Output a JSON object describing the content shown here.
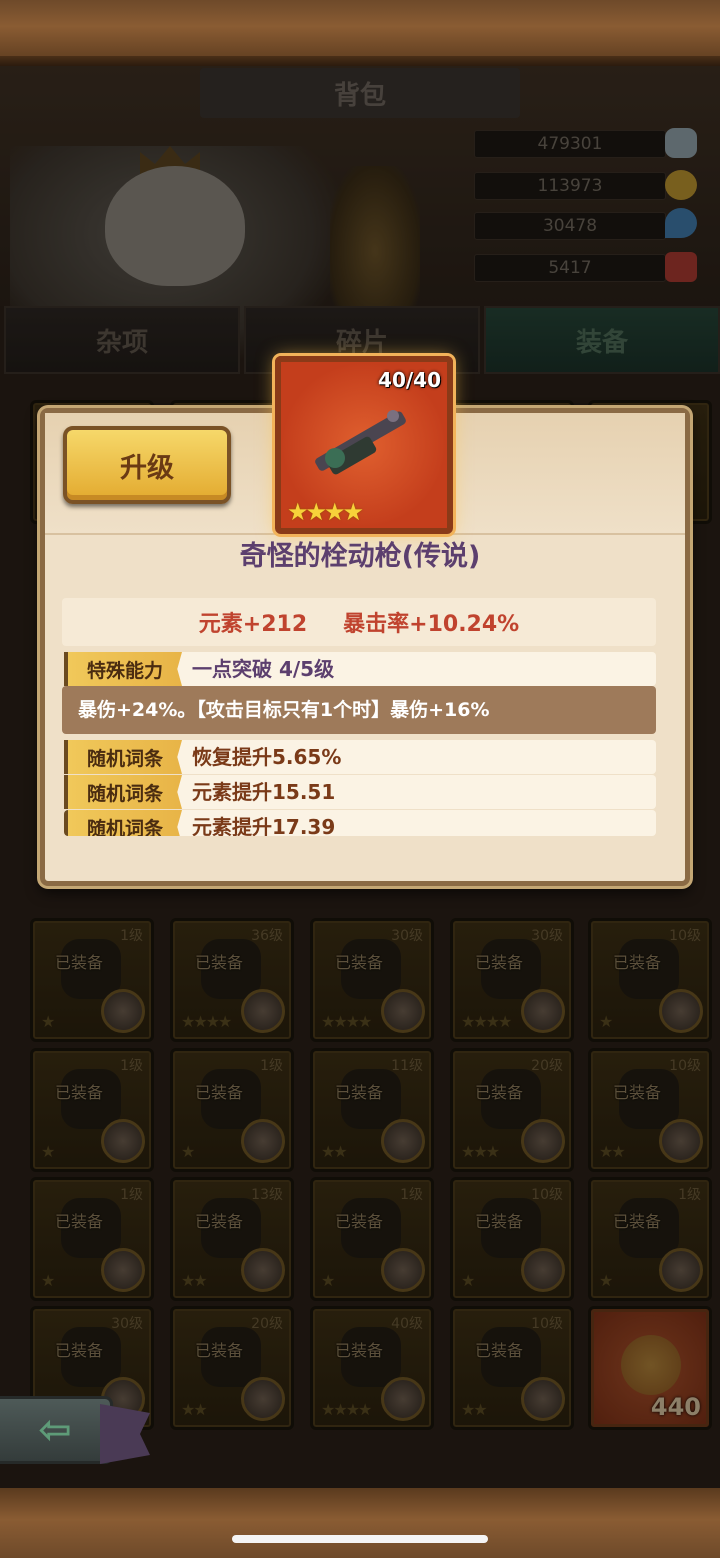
{
  "header": {
    "title": "背包",
    "resources": [
      {
        "value": "479301",
        "icon": "crystal-icon",
        "color": "#8fa0a8"
      },
      {
        "value": "113973",
        "icon": "gold-coin-icon",
        "color": "#b8922e"
      },
      {
        "value": "30478",
        "icon": "water-drop-icon",
        "color": "#3f78a8"
      },
      {
        "value": "5417",
        "icon": "red-gem-icon",
        "color": "#a83a30"
      }
    ]
  },
  "tabs": [
    "杂项",
    "碎片",
    "装备"
  ],
  "active_tab": "装备",
  "popup": {
    "upgrade_label": "升级",
    "item_count": "40/40",
    "item_stars": "★★★★",
    "item_name": "奇怪的栓动枪(传说)",
    "stat_element": "元素+212",
    "stat_crit": "暴击率+10.24%",
    "special_tag": "特殊能力",
    "special_value": "一点突破  4/5级",
    "special_desc": "暴伤+24%。【攻击目标只有1个时】暴伤+16%",
    "random_tag": "随机词条",
    "random_affixes": [
      "恢复提升5.65%",
      "元素提升15.51",
      "元素提升17.39"
    ]
  },
  "equipped_label": "已装备",
  "grid_rows": [
    [
      {
        "level": "1级",
        "stars": "★"
      },
      {
        "level": "36级",
        "stars": "★★★★"
      },
      {
        "level": "30级",
        "stars": "★★★★"
      },
      {
        "level": "30级",
        "stars": "★★★★"
      },
      {
        "level": "10级",
        "stars": "★"
      }
    ],
    [
      {
        "level": "1级",
        "stars": "★"
      },
      {
        "level": "1级",
        "stars": "★"
      },
      {
        "level": "11级",
        "stars": "★★"
      },
      {
        "level": "20级",
        "stars": "★★★"
      },
      {
        "level": "10级",
        "stars": "★★"
      }
    ],
    [
      {
        "level": "1级",
        "stars": "★"
      },
      {
        "level": "13级",
        "stars": "★★"
      },
      {
        "level": "1级",
        "stars": "★"
      },
      {
        "level": "10级",
        "stars": "★"
      },
      {
        "level": "1级",
        "stars": "★"
      }
    ],
    [
      {
        "level": "30级",
        "stars": "★★★"
      },
      {
        "level": "20级",
        "stars": "★★"
      },
      {
        "level": "40级",
        "stars": "★★★★"
      },
      {
        "level": "10级",
        "stars": "★★"
      }
    ]
  ],
  "special_cell": {
    "count": "440",
    "icon": "sun-crest-icon"
  },
  "back_icon": "back-arrow-icon"
}
